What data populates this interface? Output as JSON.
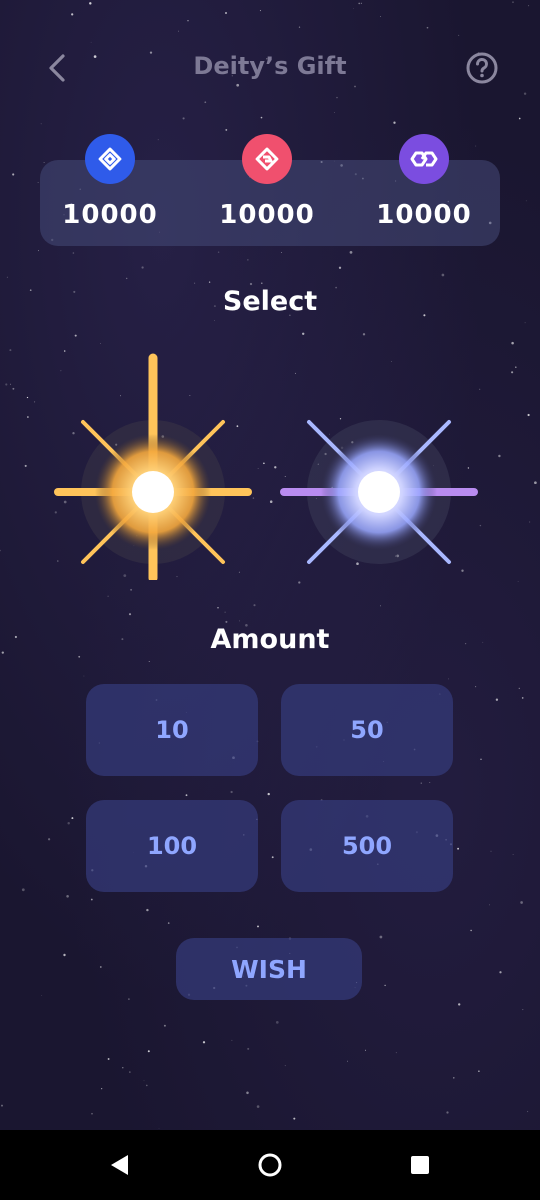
{
  "header": {
    "title": "Deity’s Gift",
    "back_icon": "chevron-left-icon",
    "help_icon": "question-circle-icon"
  },
  "balances": [
    {
      "icon": "binance-token-icon",
      "color": "#2f5bea",
      "amount": "10000"
    },
    {
      "icon": "pink-token-icon",
      "color": "#f0506e",
      "amount": "10000"
    },
    {
      "icon": "polygon-token-icon",
      "color": "#7b4de0",
      "amount": "10000"
    }
  ],
  "select": {
    "title": "Select",
    "options": [
      {
        "name": "golden-star-emblem",
        "color": "#ffc45a"
      },
      {
        "name": "celestial-star-emblem",
        "color": "#a6b4ff"
      }
    ]
  },
  "amount": {
    "title": "Amount",
    "options": [
      "10",
      "50",
      "100",
      "500"
    ]
  },
  "wish_label": "WISH",
  "colors": {
    "background": "#1a1630",
    "button_bg": "#343a78",
    "button_text": "#8fa6ff"
  },
  "navbar": {
    "back_icon": "triangle-back-icon",
    "home_icon": "circle-home-icon",
    "recents_icon": "square-recents-icon"
  }
}
